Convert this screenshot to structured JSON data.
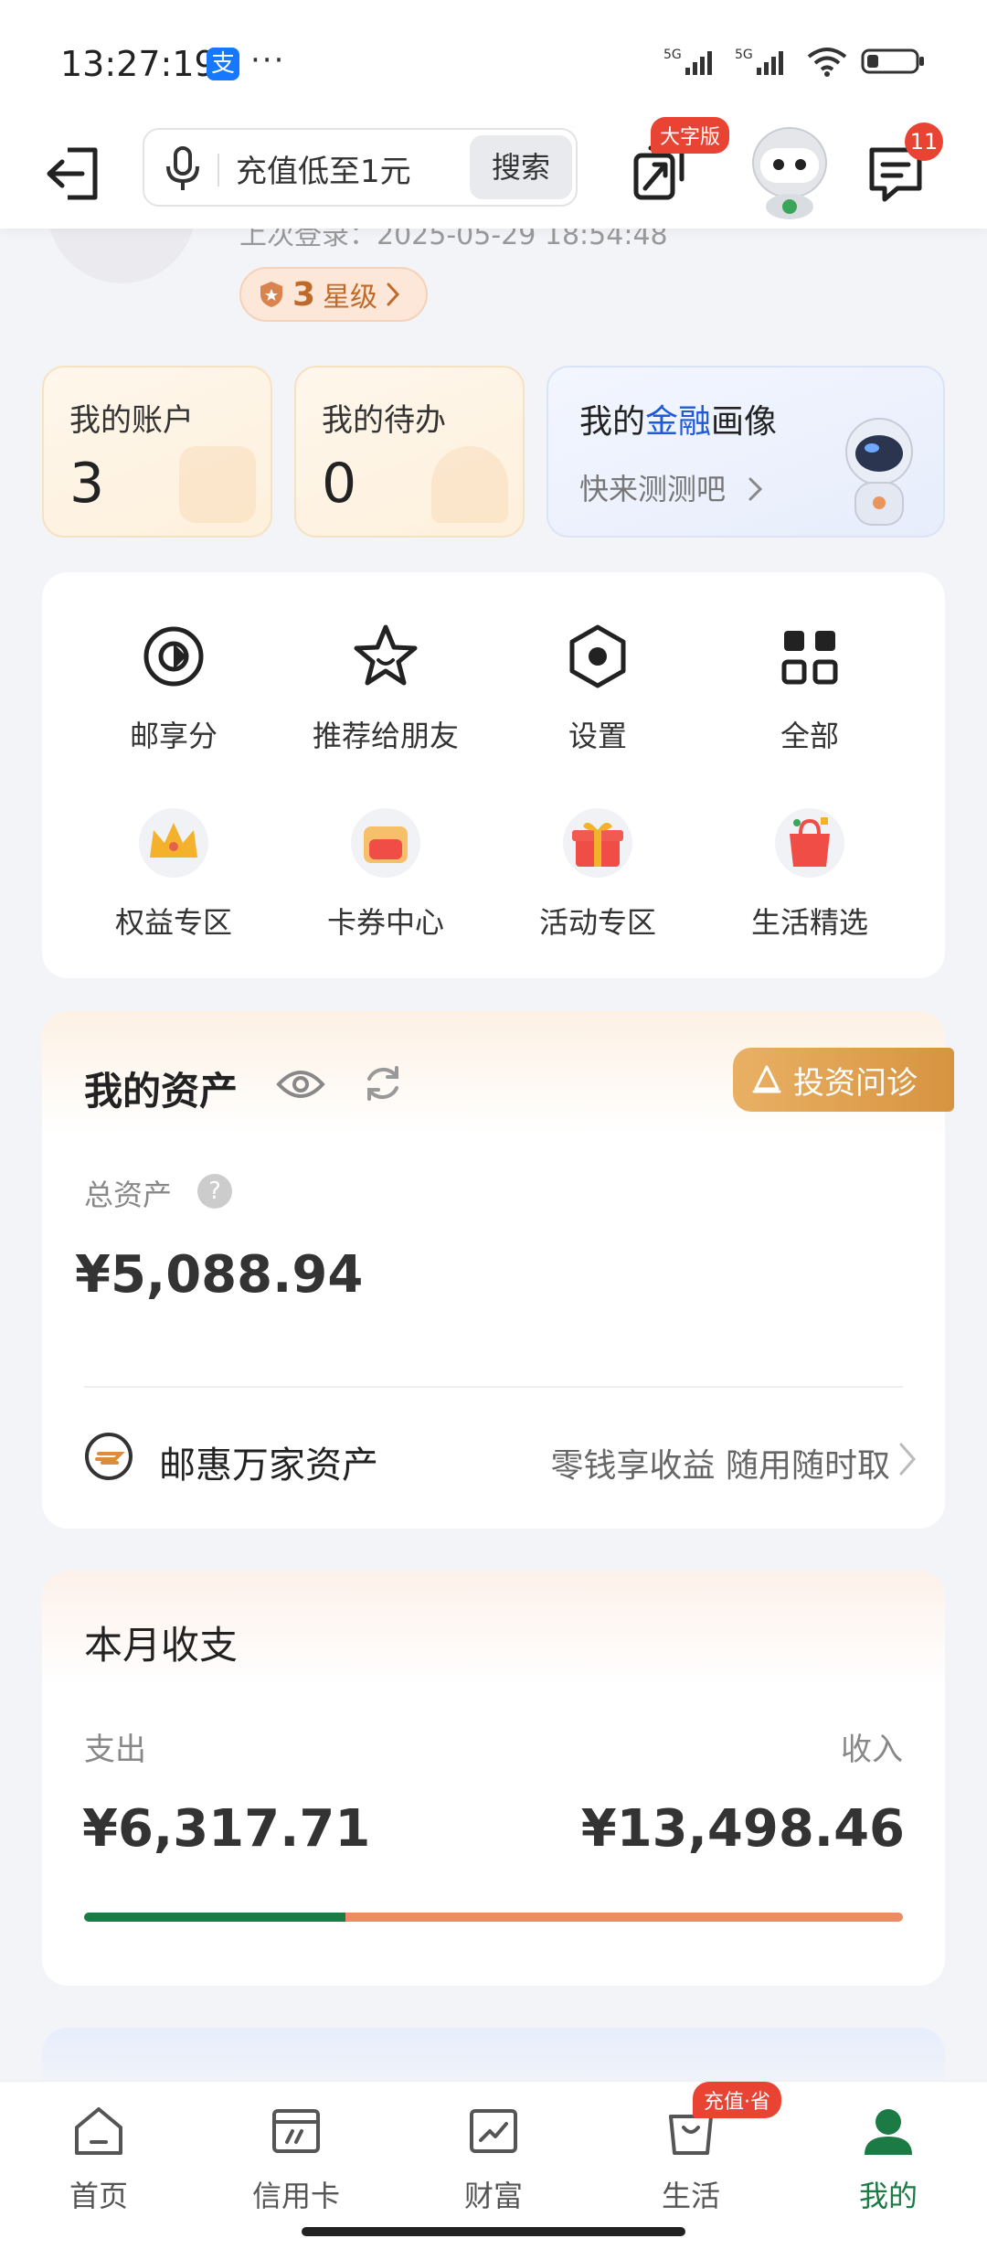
{
  "status_bar": {
    "time": "13:27:19",
    "alipay_glyph": "支",
    "dots": "···",
    "signal1": "5G",
    "signal2": "5G"
  },
  "nav": {
    "search_placeholder": "充值低至1元",
    "search_button": "搜索",
    "bigfont_badge": "大字版",
    "message_count": "11"
  },
  "profile": {
    "last_login": "上次登录：2025-05-29 18:54:48",
    "star_level": "3",
    "star_label": "星级"
  },
  "cards": {
    "accounts_label": "我的账户",
    "accounts_value": "3",
    "todo_label": "我的待办",
    "todo_value": "0",
    "finance_prefix": "我的",
    "finance_highlight": "金融",
    "finance_suffix": "画像",
    "finance_sub": "快来测测吧"
  },
  "grid": [
    {
      "label": "邮享分",
      "icon": "points-icon"
    },
    {
      "label": "推荐给朋友",
      "icon": "star-icon"
    },
    {
      "label": "设置",
      "icon": "settings-icon"
    },
    {
      "label": "全部",
      "icon": "grid-icon"
    },
    {
      "label": "权益专区",
      "icon": "crown-icon"
    },
    {
      "label": "卡券中心",
      "icon": "coupon-icon"
    },
    {
      "label": "活动专区",
      "icon": "gift-icon"
    },
    {
      "label": "生活精选",
      "icon": "shopping-bag-icon"
    }
  ],
  "assets": {
    "title": "我的资产",
    "invest_button": "投资问诊",
    "total_label": "总资产",
    "help": "?",
    "total_value": "¥5,088.94",
    "youhui_name": "邮惠万家资产",
    "youhui_desc": "零钱享收益 随用随时取"
  },
  "monthly": {
    "title": "本月收支",
    "out_label": "支出",
    "in_label": "收入",
    "out_value": "¥6,317.71",
    "in_value": "¥13,498.46",
    "out_amount": 6317.71,
    "in_amount": 13498.46
  },
  "tabs": [
    {
      "label": "首页",
      "icon": "home-icon"
    },
    {
      "label": "信用卡",
      "icon": "credit-card-icon"
    },
    {
      "label": "财富",
      "icon": "wealth-chart-icon"
    },
    {
      "label": "生活",
      "icon": "life-bag-icon"
    },
    {
      "label": "我的",
      "icon": "profile-icon",
      "active": true
    }
  ],
  "tab_badge": "充值·省",
  "colors": {
    "accent_green": "#1c7a45",
    "badge_red": "#e94333",
    "income_orange": "#ee8a64",
    "finance_blue": "#1f5bd8"
  }
}
